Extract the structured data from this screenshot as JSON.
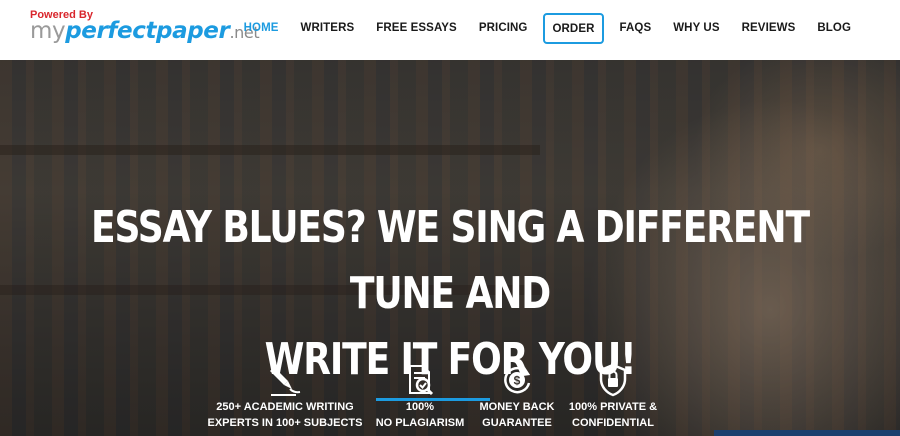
{
  "logo": {
    "powered": "Powered By",
    "my": "my",
    "perfect": "perfectpaper",
    "net": ".net"
  },
  "nav": {
    "items": [
      {
        "label": "HOME"
      },
      {
        "label": "WRITERS"
      },
      {
        "label": "FREE ESSAYS"
      },
      {
        "label": "PRICING"
      },
      {
        "label": "ORDER"
      },
      {
        "label": "FAQS"
      },
      {
        "label": "WHY US"
      },
      {
        "label": "REVIEWS"
      },
      {
        "label": "BLOG"
      }
    ]
  },
  "hero": {
    "headline_line1": "Essay blues? We sing a different tune and",
    "headline_line2": "write it for you!"
  },
  "features": [
    {
      "icon": "pen-nib-icon",
      "line1": "250+ ACADEMIC WRITING",
      "line2": "EXPERTS IN 100+ SUBJECTS"
    },
    {
      "icon": "document-check-icon",
      "line1": "100%",
      "line2": "NO PLAGIARISM"
    },
    {
      "icon": "money-back-icon",
      "line1": "MONEY BACK",
      "line2": "GUARANTEE"
    },
    {
      "icon": "lock-shield-icon",
      "line1": "100% PRIVATE &",
      "line2": "CONFIDENTIAL"
    }
  ],
  "colors": {
    "accent": "#1c9be0",
    "brand_red": "#d9262c",
    "corner": "#1a3f6e"
  }
}
